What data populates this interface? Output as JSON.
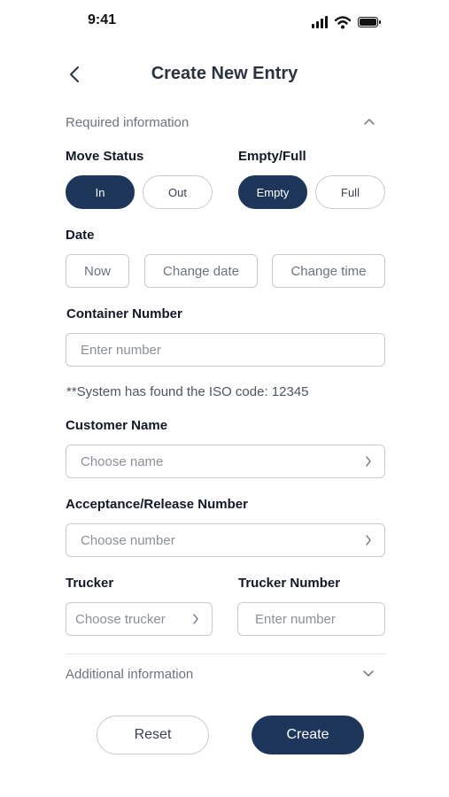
{
  "status_bar": {
    "time": "9:41",
    "icons": [
      "signal-icon",
      "wifi-icon",
      "battery-icon"
    ]
  },
  "header": {
    "title": "Create New Entry",
    "back_icon": "chevron-left-icon"
  },
  "required_section": {
    "label": "Required information",
    "toggle_icon": "chevron-up-icon",
    "expanded": true
  },
  "move_status": {
    "label": "Move Status",
    "options": [
      "In",
      "Out"
    ],
    "selected": "In"
  },
  "empty_full": {
    "label": "Empty/Full",
    "options": [
      "Empty",
      "Full"
    ],
    "selected": "Empty"
  },
  "date": {
    "label": "Date",
    "buttons": [
      "Now",
      "Change date",
      "Change time"
    ]
  },
  "container_number": {
    "label": "Container Number",
    "placeholder": "Enter number",
    "value": ""
  },
  "iso_note": "**System has found the ISO code: 12345",
  "customer_name": {
    "label": "Customer Name",
    "placeholder": "Choose name"
  },
  "acceptance_release": {
    "label": "Acceptance/Release Number",
    "placeholder": "Choose number"
  },
  "trucker": {
    "label": "Trucker",
    "placeholder": "Choose trucker"
  },
  "trucker_number": {
    "label": "Trucker Number",
    "placeholder": "Enter number",
    "value": ""
  },
  "additional_section": {
    "label": "Additional information",
    "toggle_icon": "chevron-down-icon",
    "expanded": false
  },
  "actions": {
    "reset_label": "Reset",
    "create_label": "Create"
  },
  "colors": {
    "primary": "#1e365a",
    "border": "#c5cad3",
    "muted_text": "#6b7280",
    "title": "#2b3342"
  }
}
